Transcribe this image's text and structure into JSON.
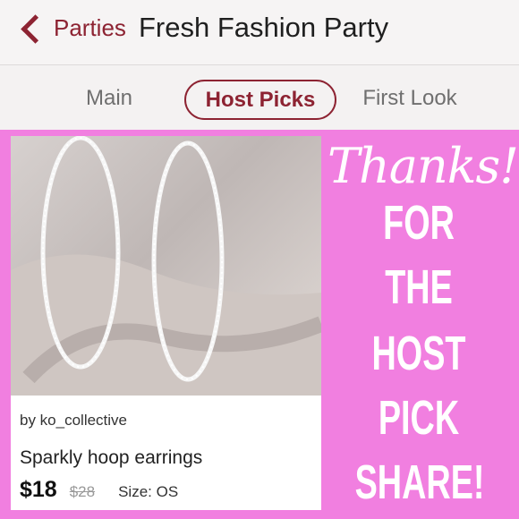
{
  "nav": {
    "back_label": "Parties",
    "title": "Fresh Fashion Party"
  },
  "tabs": [
    {
      "label": "Main",
      "selected": false
    },
    {
      "label": "Host Picks",
      "selected": true
    },
    {
      "label": "First Look",
      "selected": false
    }
  ],
  "listing": {
    "seller": "by ko_collective",
    "title": "Sparkly hoop earrings",
    "price": "$18",
    "original_price": "$28",
    "size": "Size: OS"
  },
  "overlay": {
    "script_line": "Thanks!",
    "lines": [
      "FOR",
      "THE",
      "HOST",
      "PICK",
      "SHARE!"
    ]
  },
  "colors": {
    "accent": "#8d2332",
    "background": "#f17fe0"
  }
}
